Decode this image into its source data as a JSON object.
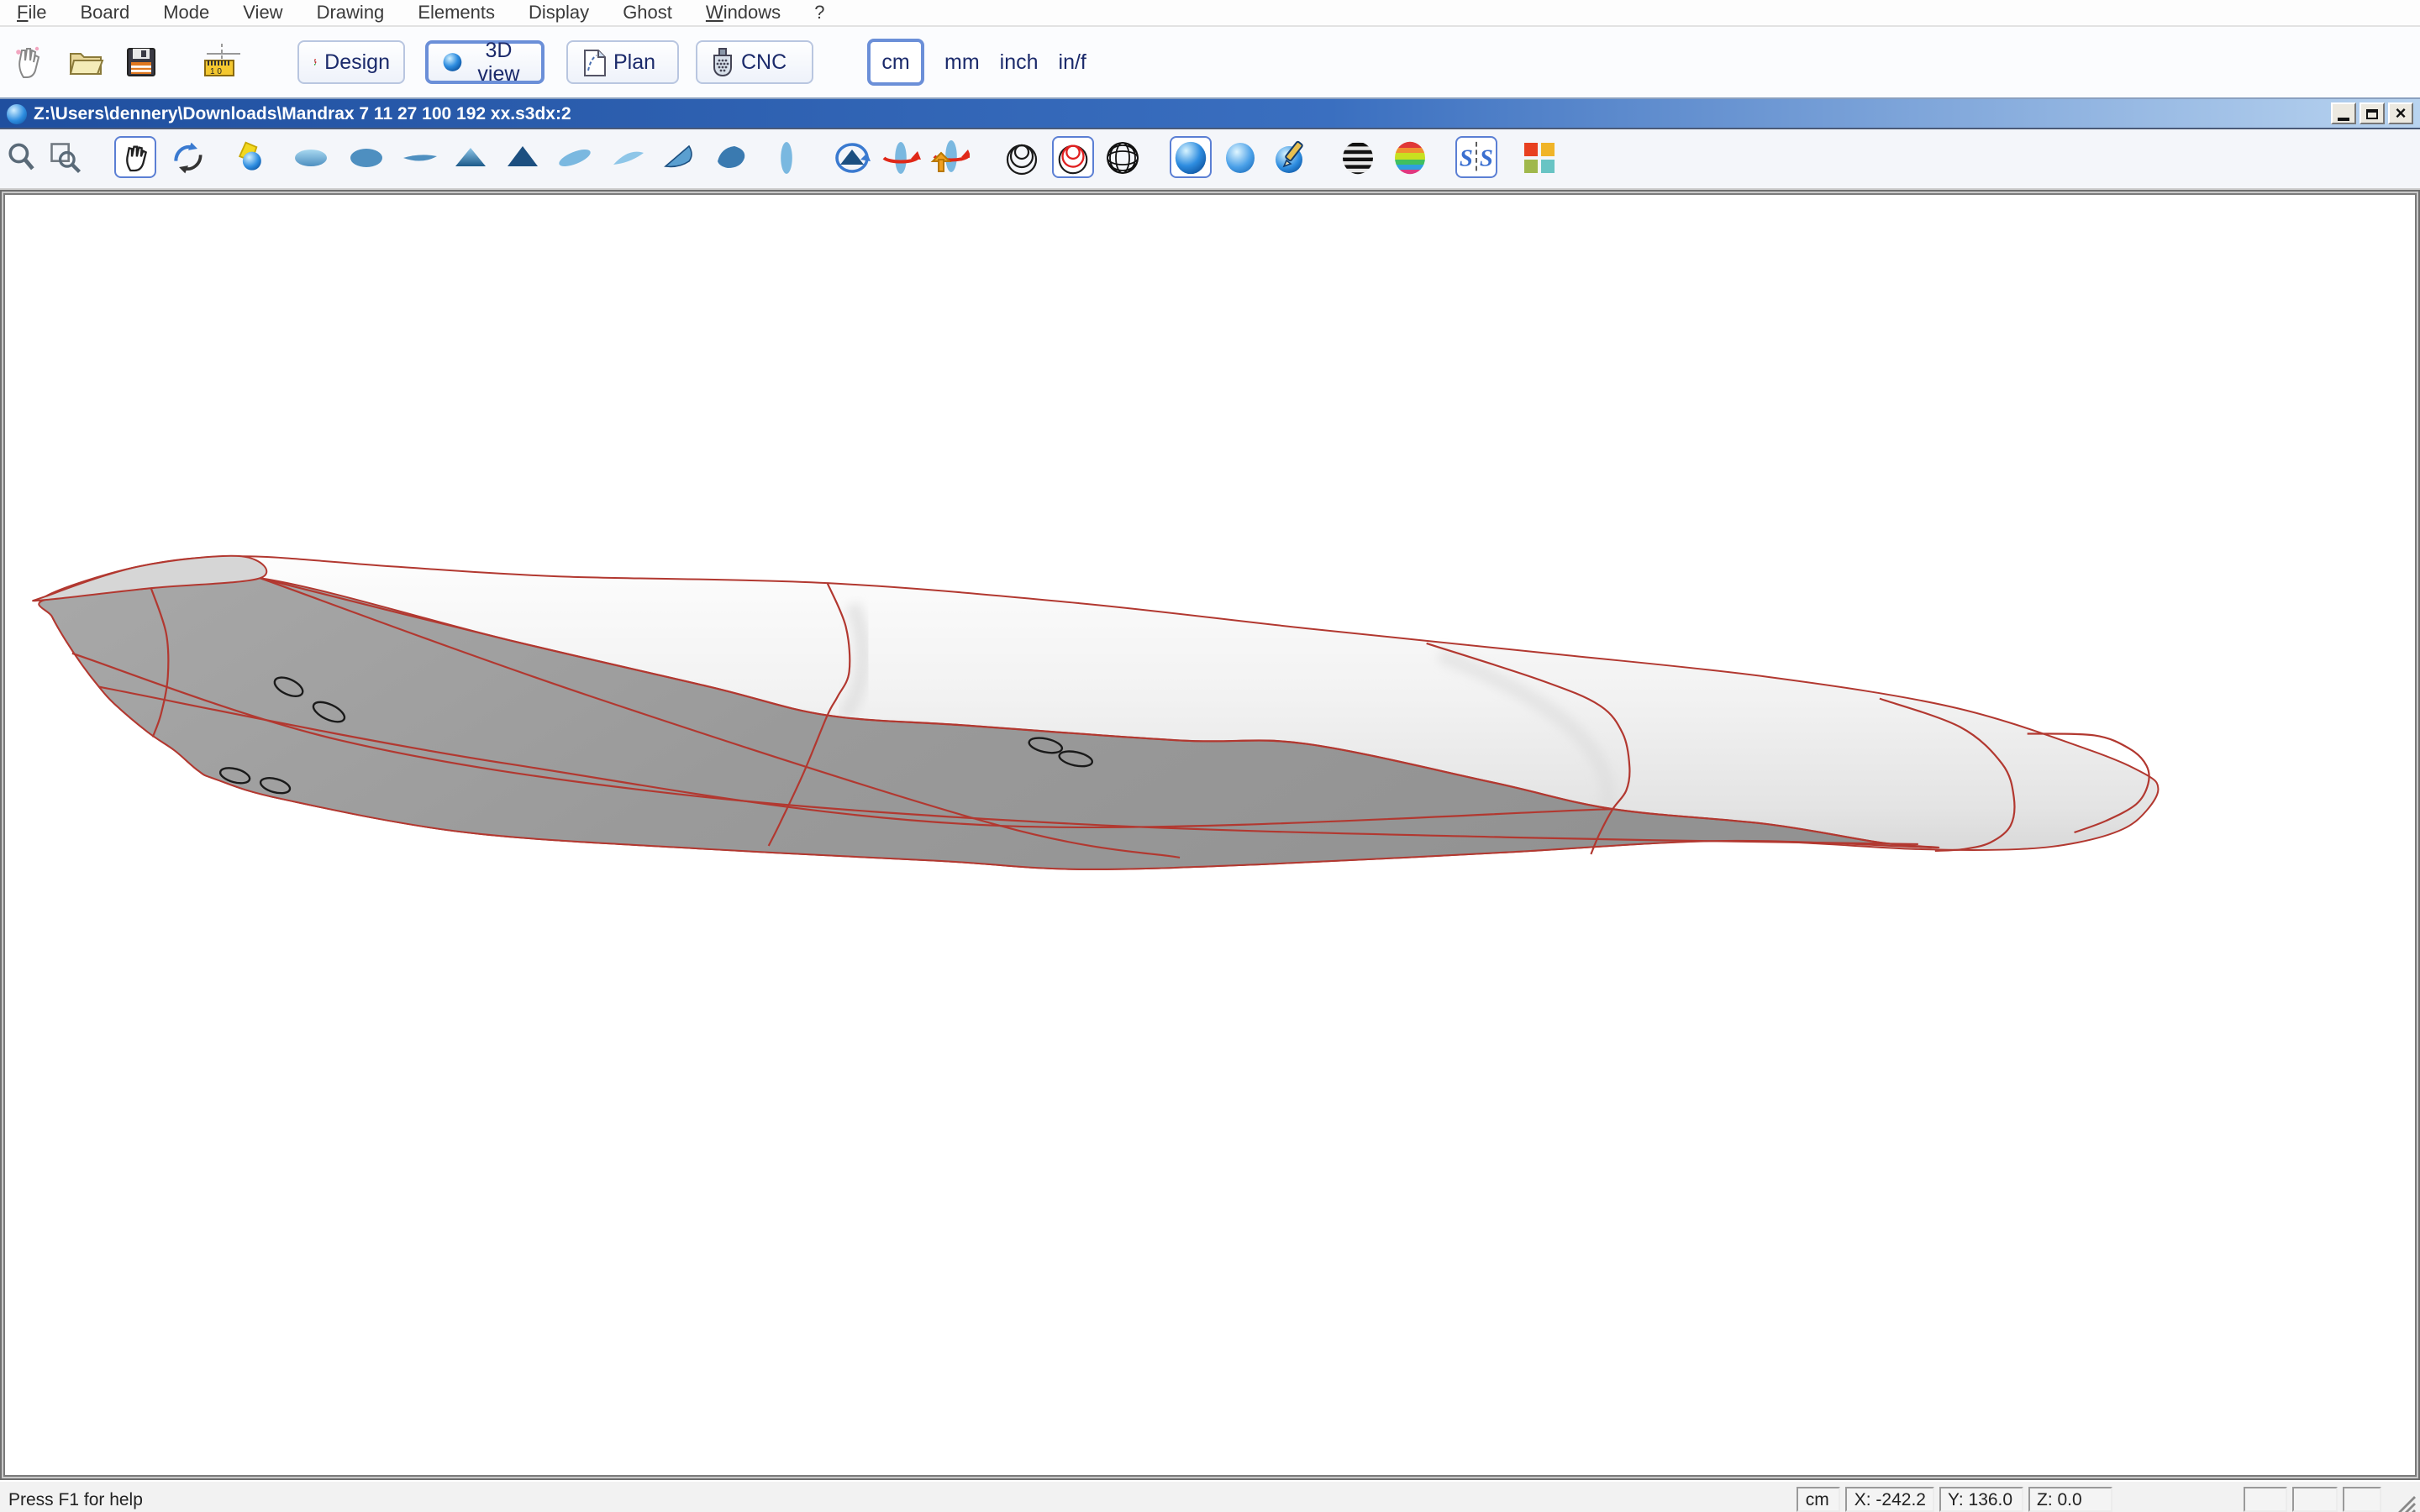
{
  "menu": [
    "File",
    "Board",
    "Mode",
    "View",
    "Drawing",
    "Elements",
    "Display",
    "Ghost",
    "Windows",
    "?"
  ],
  "toolbar_main": {
    "buttons": [
      "Design",
      "3D view",
      "Plan",
      "CNC"
    ],
    "active_button": "3D view",
    "units": [
      "cm",
      "mm",
      "inch",
      "in/f"
    ],
    "selected_unit": "cm",
    "icons": [
      "pointer-hand",
      "open-folder",
      "save-disk",
      "measurements-ruler"
    ]
  },
  "window": {
    "title": "Z:\\Users\\dennery\\Downloads\\Mandrax 7 11  27 100 192 xx.s3dx:2",
    "controls": [
      "minimize",
      "maximize",
      "close"
    ]
  },
  "toolbar_view": {
    "icons": [
      "zoom",
      "zoom-area",
      "pan-hand",
      "rotate-3d",
      "render-light",
      "view-deck",
      "view-bottom",
      "view-side",
      "view-nose",
      "view-tail",
      "view-perspective-1",
      "view-perspective-2",
      "view-perspective-3",
      "view-perspective-4",
      "view-vertical",
      "auto-rotate",
      "spin-horizontal",
      "spin-vertical",
      "show-slices",
      "show-slices-highlight",
      "wireframe-sphere",
      "solid-render",
      "smooth-render",
      "paint-design",
      "zebra-stripes",
      "curvature-map",
      "symmetry-check",
      "color-swatches"
    ],
    "selected": [
      "pan-hand",
      "show-slices-highlight",
      "solid-render",
      "symmetry-check"
    ]
  },
  "statusbar": {
    "help": "Press F1 for help",
    "unit": "cm",
    "x": "X: -242.2",
    "y": "Y: 136.0",
    "z": "Z: 0.0"
  },
  "colors": {
    "titlebar_left": "#1f4f9f",
    "titlebar_right": "#b9d4f0",
    "selection_border": "#5b7fd4",
    "accent_text": "#1b2a6b",
    "curve_red": "#b23830",
    "board_bottom_gray": "#9c9c9c",
    "board_deck_patch": "#d6d6d6"
  },
  "board": {
    "outline": [
      [
        24,
        240
      ],
      [
        80,
        222
      ],
      [
        141,
        216
      ],
      [
        230,
        222
      ],
      [
        330,
        228
      ],
      [
        490,
        232
      ],
      [
        640,
        244
      ],
      [
        775,
        259
      ],
      [
        920,
        274
      ],
      [
        1050,
        288
      ],
      [
        1160,
        306
      ],
      [
        1240,
        331
      ],
      [
        1275,
        346
      ],
      [
        1283,
        355
      ],
      [
        1276,
        368
      ],
      [
        1262,
        379
      ],
      [
        1235,
        387
      ],
      [
        1200,
        391
      ],
      [
        1140,
        391
      ],
      [
        1025,
        386
      ],
      [
        892,
        393
      ],
      [
        750,
        400
      ],
      [
        640,
        403
      ],
      [
        557,
        398
      ],
      [
        420,
        391
      ],
      [
        275,
        381
      ],
      [
        165,
        361
      ],
      [
        125,
        349
      ],
      [
        115,
        344
      ],
      [
        101,
        332
      ],
      [
        85,
        321
      ],
      [
        65,
        304
      ],
      [
        56,
        294
      ],
      [
        46,
        281
      ],
      [
        36,
        266
      ],
      [
        28,
        252
      ]
    ],
    "gray_bottom": [
      [
        24,
        242
      ],
      [
        87,
        235
      ],
      [
        152,
        229
      ],
      [
        300,
        266
      ],
      [
        420,
        294
      ],
      [
        490,
        311
      ],
      [
        572,
        317
      ],
      [
        700,
        326
      ],
      [
        775,
        328
      ],
      [
        886,
        351
      ],
      [
        958,
        367
      ],
      [
        1050,
        376
      ],
      [
        1117,
        387
      ],
      [
        1148,
        390
      ],
      [
        1025,
        386
      ],
      [
        892,
        393
      ],
      [
        750,
        400
      ],
      [
        640,
        403
      ],
      [
        557,
        398
      ],
      [
        420,
        391
      ],
      [
        275,
        381
      ],
      [
        165,
        361
      ],
      [
        125,
        349
      ],
      [
        115,
        344
      ],
      [
        101,
        332
      ],
      [
        85,
        321
      ],
      [
        65,
        304
      ],
      [
        56,
        294
      ],
      [
        46,
        281
      ],
      [
        36,
        266
      ],
      [
        28,
        252
      ]
    ],
    "tail_patch": [
      [
        24,
        240
      ],
      [
        80,
        222
      ],
      [
        141,
        216
      ],
      [
        152,
        229
      ],
      [
        87,
        235
      ],
      [
        24,
        242
      ]
    ],
    "lines": [
      [
        [
          152,
          229
        ],
        [
          300,
          266
        ],
        [
          420,
          294
        ],
        [
          490,
          311
        ],
        [
          572,
          317
        ],
        [
          700,
          326
        ],
        [
          775,
          328
        ],
        [
          886,
          351
        ],
        [
          958,
          367
        ],
        [
          1050,
          376
        ],
        [
          1117,
          387
        ],
        [
          1148,
          390
        ]
      ],
      [
        [
          40,
          274
        ],
        [
          200,
          326
        ],
        [
          400,
          358
        ],
        [
          640,
          376
        ],
        [
          900,
          384
        ],
        [
          1140,
          388
        ]
      ],
      [
        [
          152,
          229
        ],
        [
          350,
          300
        ],
        [
          593,
          377
        ],
        [
          700,
          396
        ]
      ],
      [
        [
          56,
          294
        ],
        [
          300,
          340
        ],
        [
          593,
          377
        ],
        [
          958,
          367
        ]
      ],
      [
        [
          87,
          235
        ],
        [
          96,
          262
        ],
        [
          97,
          288
        ],
        [
          93,
          310
        ],
        [
          88,
          324
        ]
      ],
      [
        [
          490,
          232
        ],
        [
          501,
          258
        ],
        [
          503,
          285
        ],
        [
          496,
          300
        ],
        [
          490,
          311
        ],
        [
          476,
          345
        ],
        [
          462,
          375
        ],
        [
          455,
          389
        ]
      ],
      [
        [
          847,
          268
        ],
        [
          915,
          290
        ],
        [
          950,
          305
        ],
        [
          964,
          322
        ],
        [
          968,
          342
        ],
        [
          966,
          356
        ],
        [
          958,
          367
        ],
        [
          950,
          382
        ],
        [
          945,
          394
        ]
      ],
      [
        [
          1117,
          301
        ],
        [
          1165,
          318
        ],
        [
          1190,
          340
        ],
        [
          1197,
          360
        ],
        [
          1195,
          377
        ],
        [
          1183,
          387
        ],
        [
          1167,
          391
        ],
        [
          1150,
          392
        ]
      ],
      [
        [
          1205,
          322
        ],
        [
          1245,
          323
        ],
        [
          1266,
          331
        ],
        [
          1276,
          341
        ],
        [
          1277,
          352
        ],
        [
          1270,
          364
        ],
        [
          1252,
          374
        ],
        [
          1233,
          381
        ]
      ]
    ],
    "fin_plugs": [
      [
        169,
        294,
        9,
        4.5,
        25
      ],
      [
        193,
        309,
        10,
        4.5,
        25
      ],
      [
        137,
        347,
        9,
        4,
        15
      ],
      [
        161,
        353,
        9,
        4,
        15
      ],
      [
        620,
        329,
        10,
        4,
        12
      ],
      [
        638,
        337,
        10,
        4,
        12
      ]
    ]
  }
}
